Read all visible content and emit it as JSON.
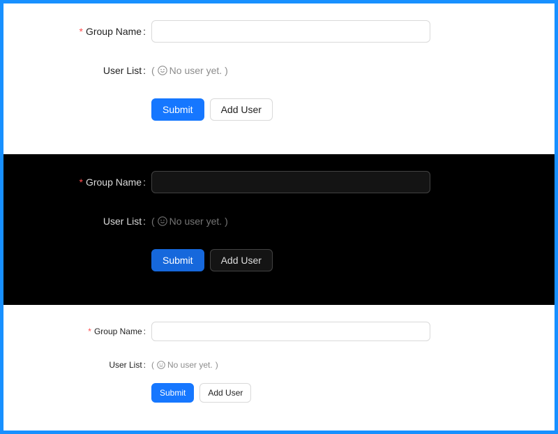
{
  "forms": [
    {
      "theme": "light",
      "size": "middle",
      "group_name": {
        "required_mark": "*",
        "label": "Group Name",
        "colon": ":",
        "value": "",
        "placeholder": ""
      },
      "user_list": {
        "label": "User List",
        "colon": ":",
        "open_paren": "(",
        "empty_text": "No user yet.",
        "close_paren": ")"
      },
      "submit_label": "Submit",
      "add_user_label": "Add User"
    },
    {
      "theme": "dark",
      "size": "middle",
      "group_name": {
        "required_mark": "*",
        "label": "Group Name",
        "colon": ":",
        "value": "",
        "placeholder": ""
      },
      "user_list": {
        "label": "User List",
        "colon": ":",
        "open_paren": "(",
        "empty_text": "No user yet.",
        "close_paren": ")"
      },
      "submit_label": "Submit",
      "add_user_label": "Add User"
    },
    {
      "theme": "light",
      "size": "small",
      "group_name": {
        "required_mark": "*",
        "label": "Group Name",
        "colon": ":",
        "value": "",
        "placeholder": ""
      },
      "user_list": {
        "label": "User List",
        "colon": ":",
        "open_paren": "(",
        "empty_text": "No user yet.",
        "close_paren": ")"
      },
      "submit_label": "Submit",
      "add_user_label": "Add User"
    }
  ],
  "icons": {
    "empty_state": "smile-icon"
  },
  "colors": {
    "frame_border": "#1890ff",
    "primary": "#1677ff",
    "required": "#ff4d4f",
    "dark_background": "#000000"
  }
}
